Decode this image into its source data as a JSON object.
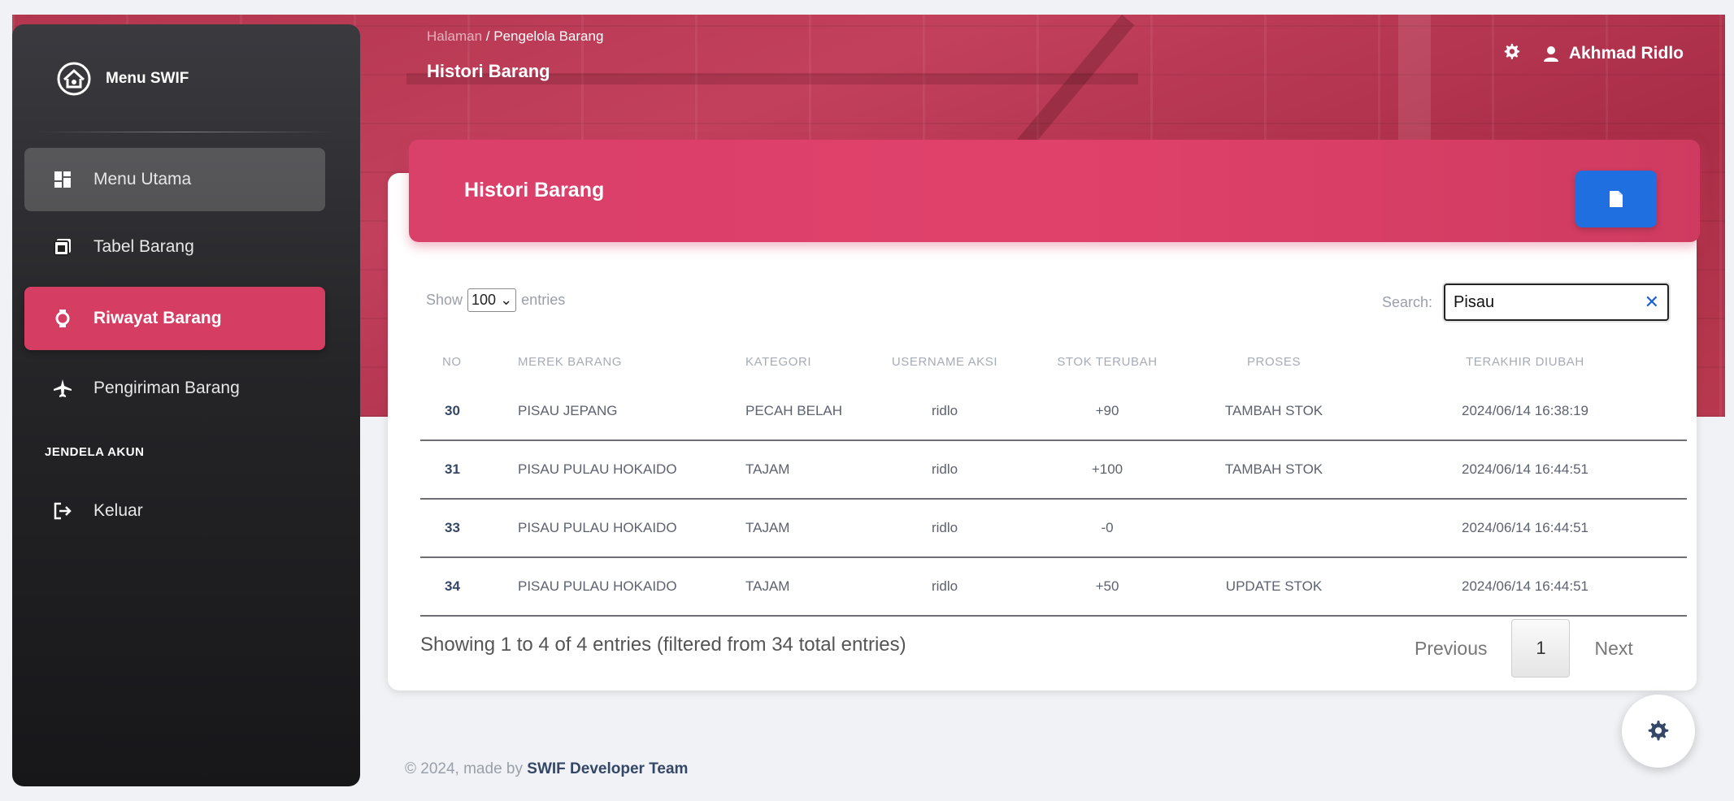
{
  "sidebar": {
    "brand": "Menu SWIF",
    "items": [
      {
        "label": "Menu Utama",
        "icon": "dashboard-icon"
      },
      {
        "label": "Tabel Barang",
        "icon": "table-icon"
      },
      {
        "label": "Riwayat Barang",
        "icon": "watch-icon"
      },
      {
        "label": "Pengiriman Barang",
        "icon": "airplane-icon"
      }
    ],
    "section": "JENDELA AKUN",
    "logout": "Keluar"
  },
  "header": {
    "breadcrumb_root": "Halaman",
    "breadcrumb_sep": "/",
    "breadcrumb_current": "Pengelola Barang",
    "title": "Histori Barang",
    "user": "Akhmad Ridlo"
  },
  "card": {
    "title": "Histori Barang",
    "show_label": "Show",
    "entries_value": "100",
    "entries_label": "entries",
    "search_label": "Search:",
    "search_value": "Pisau"
  },
  "table": {
    "headers": [
      "NO",
      "MEREK BARANG",
      "KATEGORI",
      "USERNAME AKSI",
      "STOK TERUBAH",
      "PROSES",
      "TERAKHIR DIUBAH"
    ],
    "rows": [
      [
        "30",
        "PISAU JEPANG",
        "PECAH BELAH",
        "ridlo",
        "+90",
        "TAMBAH STOK",
        "2024/06/14 16:38:19"
      ],
      [
        "31",
        "PISAU PULAU HOKAIDO",
        "TAJAM",
        "ridlo",
        "+100",
        "TAMBAH STOK",
        "2024/06/14 16:44:51"
      ],
      [
        "33",
        "PISAU PULAU HOKAIDO",
        "TAJAM",
        "ridlo",
        "-0",
        "",
        "2024/06/14 16:44:51"
      ],
      [
        "34",
        "PISAU PULAU HOKAIDO",
        "TAJAM",
        "ridlo",
        "+50",
        "UPDATE STOK",
        "2024/06/14 16:44:51"
      ]
    ]
  },
  "pagination": {
    "info": "Showing 1 to 4 of 4 entries (filtered from 34 total entries)",
    "previous": "Previous",
    "page": "1",
    "next": "Next"
  },
  "footer": {
    "prefix": "© 2024, made by",
    "team": "SWIF Developer Team"
  },
  "colors": {
    "accent": "#d63d62",
    "pdf_button": "#1f6fe0"
  }
}
